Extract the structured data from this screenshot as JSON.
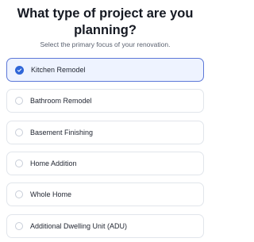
{
  "header": {
    "title_line1": "What type of project are you",
    "title_line2": "planning?",
    "subtitle": "Select the primary focus of your renovation."
  },
  "options": [
    {
      "label": "Kitchen Remodel",
      "selected": true
    },
    {
      "label": "Bathroom Remodel",
      "selected": false
    },
    {
      "label": "Basement Finishing",
      "selected": false
    },
    {
      "label": "Home Addition",
      "selected": false
    },
    {
      "label": "Whole Home",
      "selected": false
    },
    {
      "label": "Additional Dwelling Unit (ADU)",
      "selected": false
    }
  ],
  "colors": {
    "accent": "#2f66d8",
    "selected_border": "#5d78d8",
    "selected_bg": "#eef3ff",
    "option_border": "#e1e5eb"
  },
  "icons": {
    "selected_radio": "check-icon",
    "unselected_radio": "radio-circle-icon"
  }
}
